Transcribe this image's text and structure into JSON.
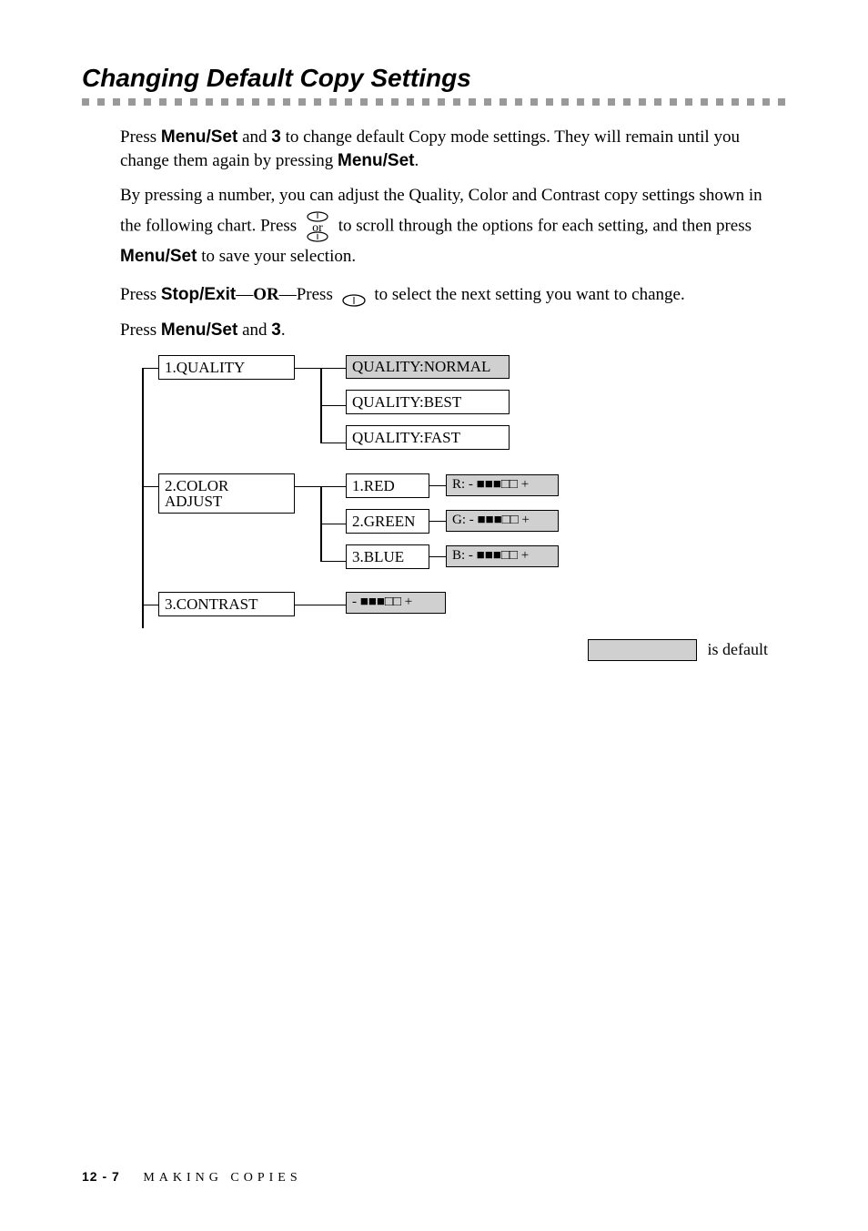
{
  "title": "Changing Default Copy Settings",
  "para1_a": "Press ",
  "para1_menu": "Menu/Set",
  "para1_b": " and ",
  "para1_three": "3",
  "para1_c": " to change default Copy mode settings. They will remain until you change them again by pressing ",
  "para1_menu2": "Menu/Set",
  "para1_d": ".",
  "para2": "By pressing a number, you can adjust the Quality, Color and Contrast copy settings shown in the following chart. Press ",
  "para2_mid": " to scroll through the options for each setting, and then press ",
  "para2_menu": "Menu/Set",
  "para2_end": " to save your selection.",
  "para3_a": "Press ",
  "para3_stop": "Stop/Exit",
  "para3_b": "—",
  "para3_or": "OR",
  "para3_c": "—Press ",
  "para3_d": " to select the next setting you want to change.",
  "para4_a": "Press ",
  "para4_menu": "Menu/Set",
  "para4_b": " and ",
  "para4_three": "3",
  "para4_c": ".",
  "or_label": "or",
  "diagram": {
    "quality": {
      "label": "1.QUALITY",
      "opts": [
        "QUALITY:NORMAL",
        "QUALITY:BEST",
        "QUALITY:FAST"
      ],
      "default_index": 0
    },
    "coloradjust": {
      "label": "2.COLOR ADJUST",
      "channels": [
        {
          "label": "1.RED",
          "scale": "R: - ■■■□□ +"
        },
        {
          "label": "2.GREEN",
          "scale": "G: - ■■■□□ +"
        },
        {
          "label": "3.BLUE",
          "scale": "B: - ■■■□□ +"
        }
      ]
    },
    "contrast": {
      "label": "3.CONTRAST",
      "scale": "- ■■■□□ +"
    }
  },
  "default_legend": "is default",
  "footer": {
    "page": "12 - 7",
    "chapter": "MAKING COPIES"
  }
}
